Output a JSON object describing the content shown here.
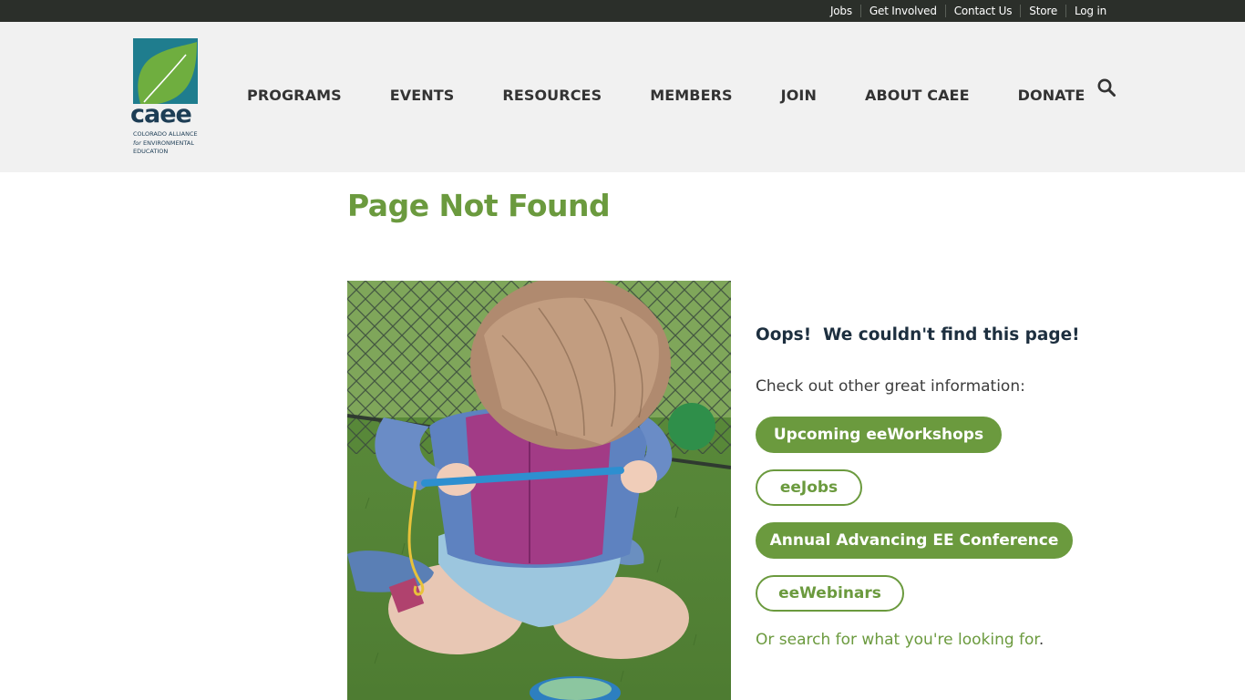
{
  "topbar": {
    "links": [
      "Jobs",
      "Get Involved",
      "Contact Us",
      "Store",
      "Log in"
    ]
  },
  "logo": {
    "word": "caee",
    "tagline_1": "COLORADO ALLIANCE",
    "tagline_2_italic": "for",
    "tagline_2": "ENVIRONMENTAL",
    "tagline_3": "EDUCATION"
  },
  "nav": {
    "items": [
      "PROGRAMS",
      "EVENTS",
      "RESOURCES",
      "MEMBERS",
      "JOIN",
      "ABOUT CAEE",
      "DONATE"
    ],
    "search_icon": "search-icon"
  },
  "main": {
    "title": "Page Not Found",
    "oops": "Oops!  We couldn't find this page!",
    "checkout": "Check out other great information:",
    "buttons": [
      "Upcoming eeWorkshops",
      "eeJobs",
      "Annual Advancing EE Conference",
      "eeWebinars"
    ],
    "search_link": "Or search for what you're looking for",
    "search_period": "."
  },
  "colors": {
    "accent_green": "#6b9a3e",
    "topbar": "#2b2f2a",
    "header_bg": "#f1f1f1",
    "logo_teal": "#1f7d8e",
    "logo_leaf": "#6fae3f",
    "navy": "#1d2f3f"
  }
}
